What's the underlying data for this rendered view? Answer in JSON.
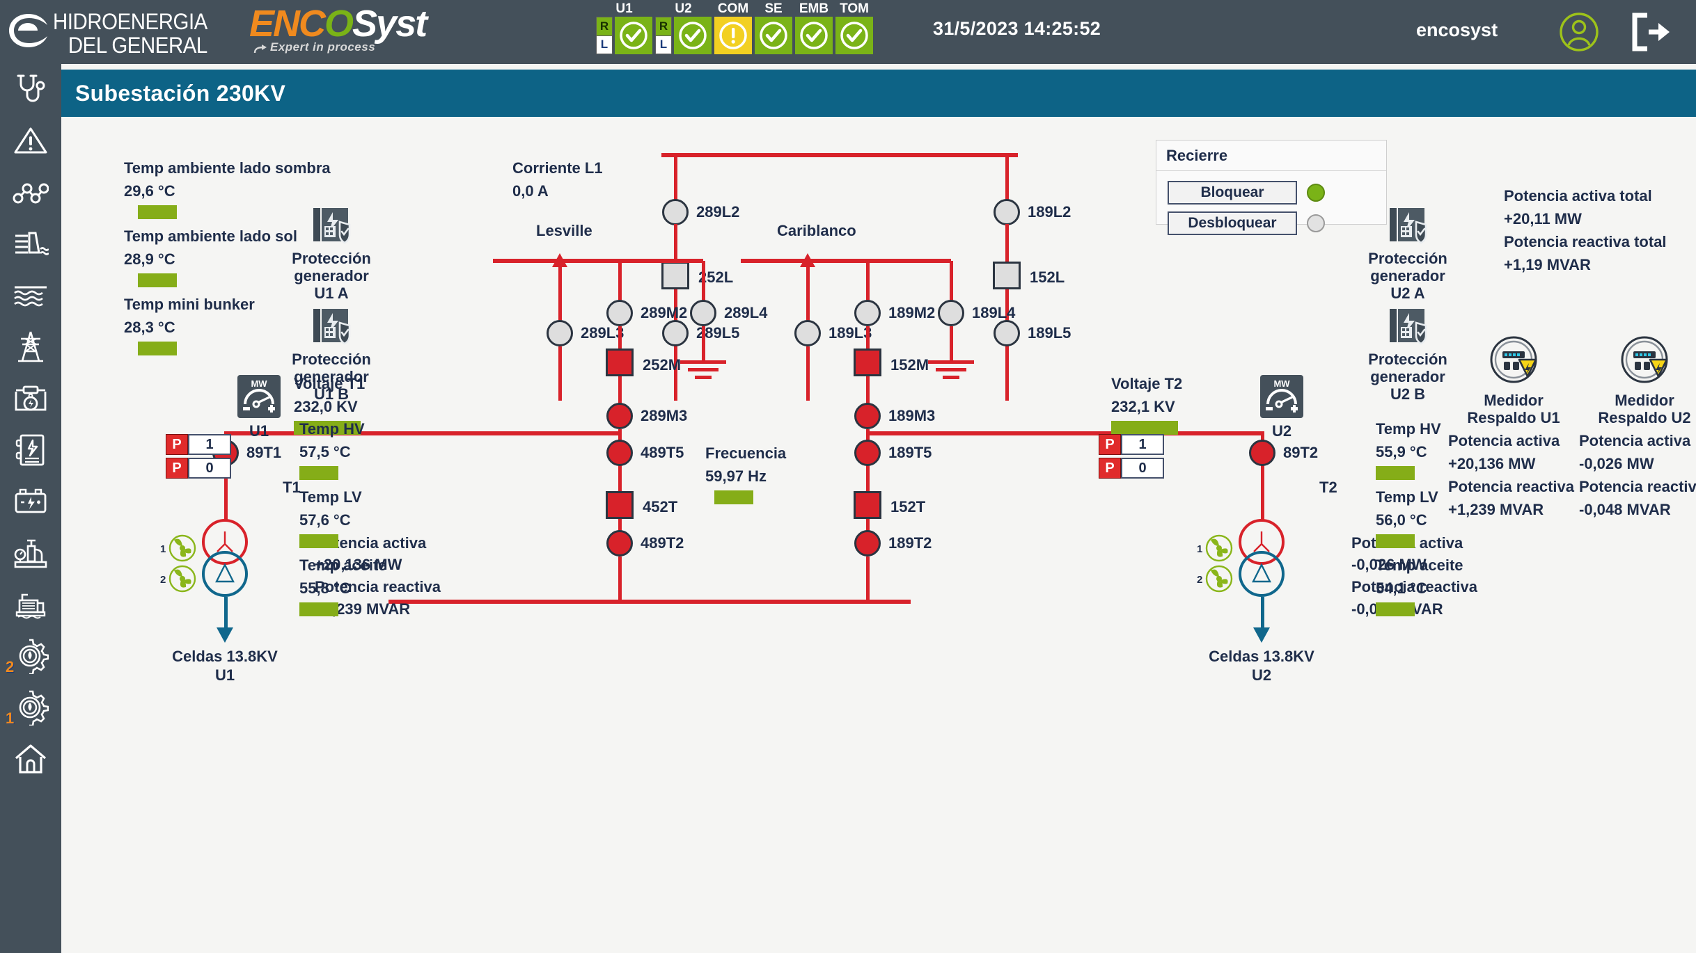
{
  "header": {
    "brand_primary_line1": "HIDROENERGIA",
    "brand_primary_line2": "DEL GENERAL",
    "brand_secondary_en": "ENC",
    "brand_secondary_o": "O",
    "brand_secondary_syst": "Syst",
    "brand_tagline": "Expert in process",
    "datetime": "31/5/2023 14:25:52",
    "user": "encosyst",
    "status": [
      {
        "label": "U1",
        "has_rl": true,
        "r": "R",
        "l": "L",
        "state": "ok"
      },
      {
        "label": "U2",
        "has_rl": true,
        "r": "R",
        "l": "L",
        "state": "ok"
      },
      {
        "label": "COM",
        "has_rl": false,
        "state": "warn"
      },
      {
        "label": "SE",
        "has_rl": false,
        "state": "ok"
      },
      {
        "label": "EMB",
        "has_rl": false,
        "state": "ok"
      },
      {
        "label": "TOM",
        "has_rl": false,
        "state": "ok"
      }
    ]
  },
  "sidebar": {
    "items": [
      {
        "icon": "stethoscope-icon",
        "badge": ""
      },
      {
        "icon": "alert-triangle-icon",
        "badge": ""
      },
      {
        "icon": "network-nodes-icon",
        "badge": ""
      },
      {
        "icon": "dam-icon",
        "badge": ""
      },
      {
        "icon": "water-waves-icon",
        "badge": ""
      },
      {
        "icon": "transmission-tower-icon",
        "badge": ""
      },
      {
        "icon": "generator-circuit-icon",
        "badge": ""
      },
      {
        "icon": "electrical-report-icon",
        "badge": ""
      },
      {
        "icon": "battery-icon",
        "badge": ""
      },
      {
        "icon": "valve-gauge-icon",
        "badge": ""
      },
      {
        "icon": "pump-motor-icon",
        "badge": ""
      },
      {
        "icon": "turbine-gear-icon",
        "badge": "2"
      },
      {
        "icon": "turbine-gear-icon",
        "badge": "1"
      },
      {
        "icon": "home-icon",
        "badge": ""
      }
    ]
  },
  "page": {
    "title": "Subestación 230KV"
  },
  "ambient": [
    {
      "label": "Temp ambiente lado sombra",
      "value": "29,6 °C",
      "status": "ok"
    },
    {
      "label": "Temp ambiente lado sol",
      "value": "28,9 °C",
      "status": "ok"
    },
    {
      "label": "Temp mini bunker",
      "value": "28,3 °C",
      "status": "ok"
    }
  ],
  "current_l1": {
    "label": "Corriente L1",
    "value": "0,0 A"
  },
  "frecuencia": {
    "label": "Frecuencia",
    "value": "59,97 Hz",
    "status": "ok"
  },
  "feeders": {
    "left": "Lesville",
    "right": "Cariblanco"
  },
  "recierre": {
    "title": "Recierre",
    "bloquear_label": "Bloquear",
    "desbloquear_label": "Desbloquear",
    "bloquear_state": "on",
    "desbloquear_state": "off"
  },
  "totals": {
    "activa_label": "Potencia activa total",
    "activa_value": "+20,11 MW",
    "reactiva_label": "Potencia reactiva total",
    "reactiva_value": "+1,19 MVAR"
  },
  "medidores": [
    {
      "icon": "meter-hazard-icon",
      "name_line1": "Medidor",
      "name_line2": "Respaldo U1",
      "activa_label": "Potencia activa",
      "activa_value": "+20,136 MW",
      "reactiva_label": "Potencia reactiva",
      "reactiva_value": "+1,239 MVAR"
    },
    {
      "icon": "meter-hazard-icon",
      "name_line1": "Medidor",
      "name_line2": "Respaldo U2",
      "activa_label": "Potencia activa",
      "activa_value": "-0,026 MW",
      "reactiva_label": "Potencia reactiva",
      "reactiva_value": "-0,048 MVAR"
    }
  ],
  "protections": {
    "left": [
      {
        "icon": "protection-relay-icon",
        "l1": "Protección",
        "l2": "generador",
        "l3": "U1 A"
      },
      {
        "icon": "protection-relay-icon",
        "l1": "Protección",
        "l2": "generador",
        "l3": "U1 B"
      }
    ],
    "right": [
      {
        "icon": "protection-relay-icon",
        "l1": "Protección",
        "l2": "generador",
        "l3": "U2 A"
      },
      {
        "icon": "protection-relay-icon",
        "l1": "Protección",
        "l2": "generador",
        "l3": "U2 B"
      }
    ]
  },
  "transformer_temps": {
    "left": [
      {
        "label": "Temp HV",
        "value": "57,5 °C",
        "status": "ok"
      },
      {
        "label": "Temp LV",
        "value": "57,6 °C",
        "status": "ok"
      },
      {
        "label": "Temp aceite",
        "value": "55,8 °C",
        "status": "ok"
      }
    ],
    "right": [
      {
        "label": "Temp HV",
        "value": "55,9 °C",
        "status": "ok"
      },
      {
        "label": "Temp LV",
        "value": "56,0 °C",
        "status": "ok"
      },
      {
        "label": "Temp aceite",
        "value": "54,1 °C",
        "status": "ok"
      }
    ]
  },
  "units": {
    "u1": {
      "meter_icon": "mw-gauge-icon",
      "meter_label": "U1",
      "voltage_label": "Voltaje T1",
      "voltage_value": "232,0 KV",
      "tap_rows": [
        {
          "tag": "P",
          "value": "1"
        },
        {
          "tag": "P",
          "value": "0"
        }
      ],
      "transformer_label": "T1",
      "activa_label": "Potencia activa",
      "activa_value": "+20,136 MW",
      "reactiva_label": "Potencia reactiva",
      "reactiva_value": "+1,239 MVAR",
      "outgoing_line1": "Celdas 13.8KV",
      "outgoing_line2": "U1",
      "fans": [
        "1",
        "2"
      ]
    },
    "u2": {
      "meter_icon": "mw-gauge-icon",
      "meter_label": "U2",
      "voltage_label": "Voltaje T2",
      "voltage_value": "232,1 KV",
      "tap_rows": [
        {
          "tag": "P",
          "value": "1"
        },
        {
          "tag": "P",
          "value": "0"
        }
      ],
      "transformer_label": "T2",
      "activa_label": "Potencia activa",
      "activa_value": "-0,026 MW",
      "reactiva_label": "Potencia reactiva",
      "reactiva_value": "-0,048 MVAR",
      "outgoing_line1": "Celdas 13.8KV",
      "outgoing_line2": "U2",
      "fans": [
        "1",
        "2"
      ]
    }
  },
  "devices": {
    "left_branch": [
      {
        "id": "289L2",
        "type": "disconnector",
        "state": "open"
      },
      {
        "id": "252L",
        "type": "breaker-square",
        "state": "open"
      },
      {
        "id": "289L3",
        "type": "disconnector",
        "state": "open"
      },
      {
        "id": "289L5",
        "type": "disconnector",
        "state": "open"
      },
      {
        "id": "289M2",
        "type": "disconnector",
        "state": "open"
      },
      {
        "id": "289L4",
        "type": "disconnector",
        "state": "open"
      },
      {
        "id": "252M",
        "type": "breaker-square",
        "state": "closed"
      },
      {
        "id": "289M3",
        "type": "disconnector",
        "state": "closed"
      },
      {
        "id": "89T1",
        "type": "disconnector",
        "state": "closed"
      },
      {
        "id": "489T5",
        "type": "disconnector",
        "state": "closed"
      },
      {
        "id": "452T",
        "type": "breaker-square",
        "state": "closed"
      },
      {
        "id": "489T2",
        "type": "disconnector",
        "state": "closed"
      }
    ],
    "right_branch": [
      {
        "id": "189L2",
        "type": "disconnector",
        "state": "open"
      },
      {
        "id": "152L",
        "type": "breaker-square",
        "state": "open"
      },
      {
        "id": "189L3",
        "type": "disconnector",
        "state": "open"
      },
      {
        "id": "189L5",
        "type": "disconnector",
        "state": "open"
      },
      {
        "id": "189M2",
        "type": "disconnector",
        "state": "open"
      },
      {
        "id": "189L4",
        "type": "disconnector",
        "state": "open"
      },
      {
        "id": "152M",
        "type": "breaker-square",
        "state": "closed"
      },
      {
        "id": "189M3",
        "type": "disconnector",
        "state": "closed"
      },
      {
        "id": "189T5",
        "type": "disconnector",
        "state": "closed"
      },
      {
        "id": "152T",
        "type": "breaker-square",
        "state": "closed"
      },
      {
        "id": "189T2",
        "type": "disconnector",
        "state": "closed"
      },
      {
        "id": "89T2",
        "type": "disconnector",
        "state": "closed"
      }
    ]
  },
  "colors": {
    "header_bg": "#44505a",
    "title_bg": "#0d6386",
    "energized": "#d8222a",
    "deenergized": "#dedede",
    "ok_green": "#85ad18",
    "warn_yellow": "#f2d022",
    "lv_blue": "#10678c",
    "text": "#1f2d4a"
  }
}
